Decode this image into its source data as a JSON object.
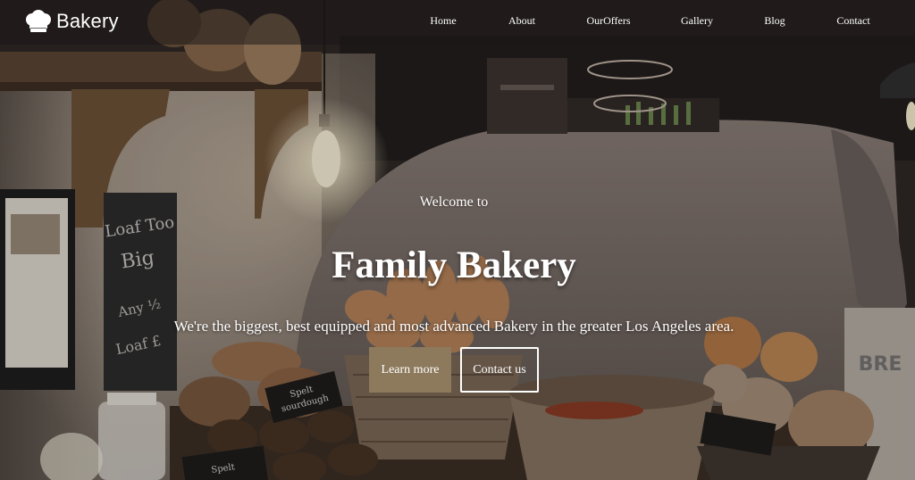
{
  "brand": {
    "name": "Bakery",
    "logo_icon": "chef-hat-icon"
  },
  "nav": {
    "items": [
      {
        "label": "Home"
      },
      {
        "label": "About"
      },
      {
        "label": "OurOffers"
      },
      {
        "label": "Gallery"
      },
      {
        "label": "Blog"
      },
      {
        "label": "Contact"
      }
    ]
  },
  "hero": {
    "welcome": "Welcome to",
    "title": "Family Bakery",
    "subtitle": "We're the biggest, best equipped and most advanced Bakery in the greater Los Angeles area.",
    "primary_button": "Learn more",
    "secondary_button": "Contact us"
  },
  "colors": {
    "nav_bg": "#19161680",
    "primary_button_bg": "#8d7a5c",
    "text": "#ffffff"
  }
}
